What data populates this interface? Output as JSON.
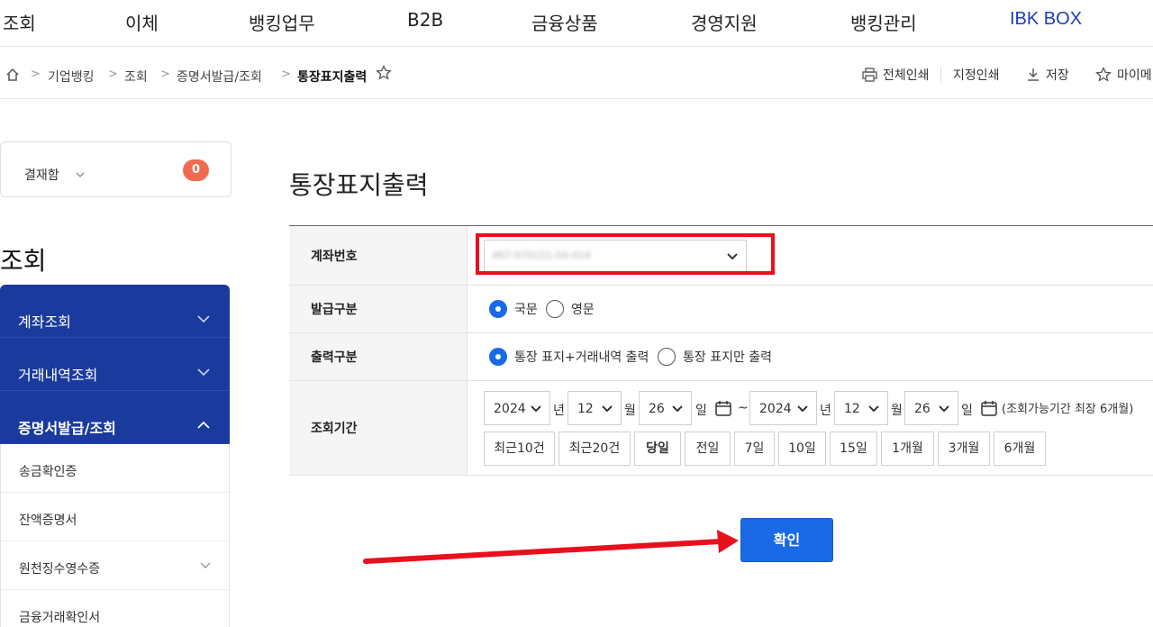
{
  "topnav": {
    "items": [
      "조회",
      "이체",
      "뱅킹업무",
      "B2B",
      "금융상품",
      "경영지원",
      "뱅킹관리",
      "IBK BOX"
    ]
  },
  "breadcrumb": {
    "items": [
      "기업뱅킹",
      "조회",
      "증명서발급/조회",
      "통장표지출력"
    ],
    "separator": ">"
  },
  "tools": {
    "print_all": "전체인쇄",
    "print_selected": "지정인쇄",
    "save": "저장",
    "my_menu": "마이메"
  },
  "sidebar": {
    "approval_label": "결재함",
    "approval_count": "0",
    "section_title": "조회",
    "groups": [
      "계좌조회",
      "거래내역조회",
      "증명서발급/조회"
    ],
    "subitems": [
      "송금확인증",
      "잔액증명서",
      "원천징수영수증",
      "금융거래확인서"
    ]
  },
  "main": {
    "title": "통장표지출력",
    "account_label": "계좌번호",
    "account_value": "467-070151-04-014",
    "issue_label": "발급구분",
    "issue_options": [
      "국문",
      "영문"
    ],
    "output_label": "출력구분",
    "output_options": [
      "통장 표지+거래내역 출력",
      "통장 표지만 출력"
    ],
    "period_label": "조회기간",
    "from": {
      "year": "2024",
      "month": "12",
      "day": "26"
    },
    "to": {
      "year": "2024",
      "month": "12",
      "day": "26"
    },
    "units": {
      "year": "년",
      "month": "월",
      "day": "일",
      "tilde": "~"
    },
    "period_note": "(조회가능기간 최장 6개월)",
    "quick_buttons": [
      "최근10건",
      "최근20건",
      "당일",
      "전일",
      "7일",
      "10일",
      "15일",
      "1개월",
      "3개월",
      "6개월"
    ],
    "confirm_label": "확인"
  },
  "colors": {
    "brand": "#1a3fb3",
    "sidebar_bg": "#1a3a9e",
    "primary_button": "#1a6ae6",
    "annotation_red": "#e8101d",
    "badge": "#f06a50"
  }
}
